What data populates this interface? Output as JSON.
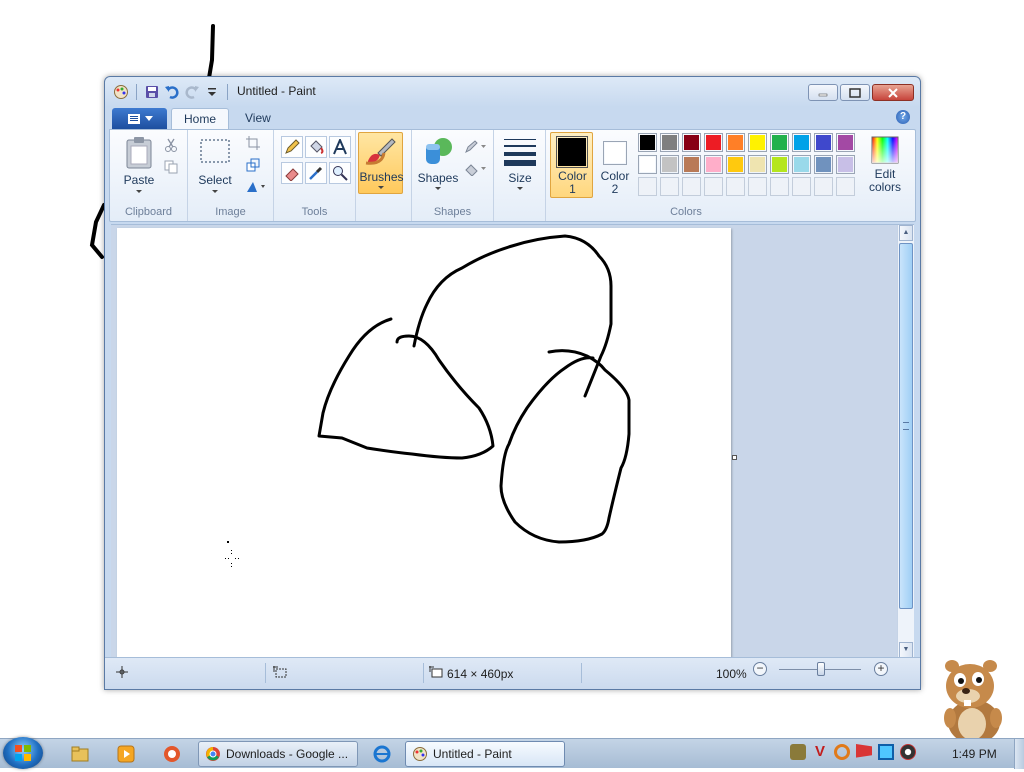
{
  "window": {
    "title": "Untitled - Paint"
  },
  "tabs": [
    {
      "label": "Home",
      "active": true
    },
    {
      "label": "View",
      "active": false
    }
  ],
  "help_glyph": "?",
  "ribbon": {
    "clipboard": {
      "group_label": "Clipboard",
      "paste_label": "Paste"
    },
    "image": {
      "group_label": "Image",
      "select_label": "Select"
    },
    "tools": {
      "group_label": "Tools"
    },
    "brushes": {
      "label": "Brushes",
      "selected": true
    },
    "shapes": {
      "group_label": "Shapes",
      "shapes_label": "Shapes"
    },
    "size": {
      "label": "Size"
    },
    "colors": {
      "group_label": "Colors",
      "color1_label_line1": "Color",
      "color1_label_line2": "1",
      "color2_label_line1": "Color",
      "color2_label_line2": "2",
      "edit_label_line1": "Edit",
      "edit_label_line2": "colors",
      "color1_value": "#000000",
      "color2_value": "#ffffff",
      "palette_row1": [
        "#000000",
        "#7f7f7f",
        "#880015",
        "#ed1c24",
        "#ff7f27",
        "#fff200",
        "#22b14c",
        "#00a2e8",
        "#3f48cc",
        "#a349a4"
      ],
      "palette_row2": [
        "#ffffff",
        "#c3c3c3",
        "#b97a57",
        "#ffaec9",
        "#ffc90e",
        "#efe4b0",
        "#b5e61d",
        "#99d9ea",
        "#7092be",
        "#c8bfe7"
      ]
    }
  },
  "status": {
    "canvas_size": "614 × 460px",
    "zoom": "100%",
    "zoom_level_percent": 100
  },
  "taskbar": {
    "tasks": [
      {
        "label": "Downloads - Google ...",
        "active": false
      },
      {
        "label": "Untitled - Paint",
        "active": true
      }
    ],
    "clock": "1:49 PM"
  },
  "colors": {
    "accent_selected": "#ffc95c",
    "window_frame": "#c7d9ef",
    "canvas_bg": "#c9d6e9",
    "close_button": "#c7443b"
  }
}
